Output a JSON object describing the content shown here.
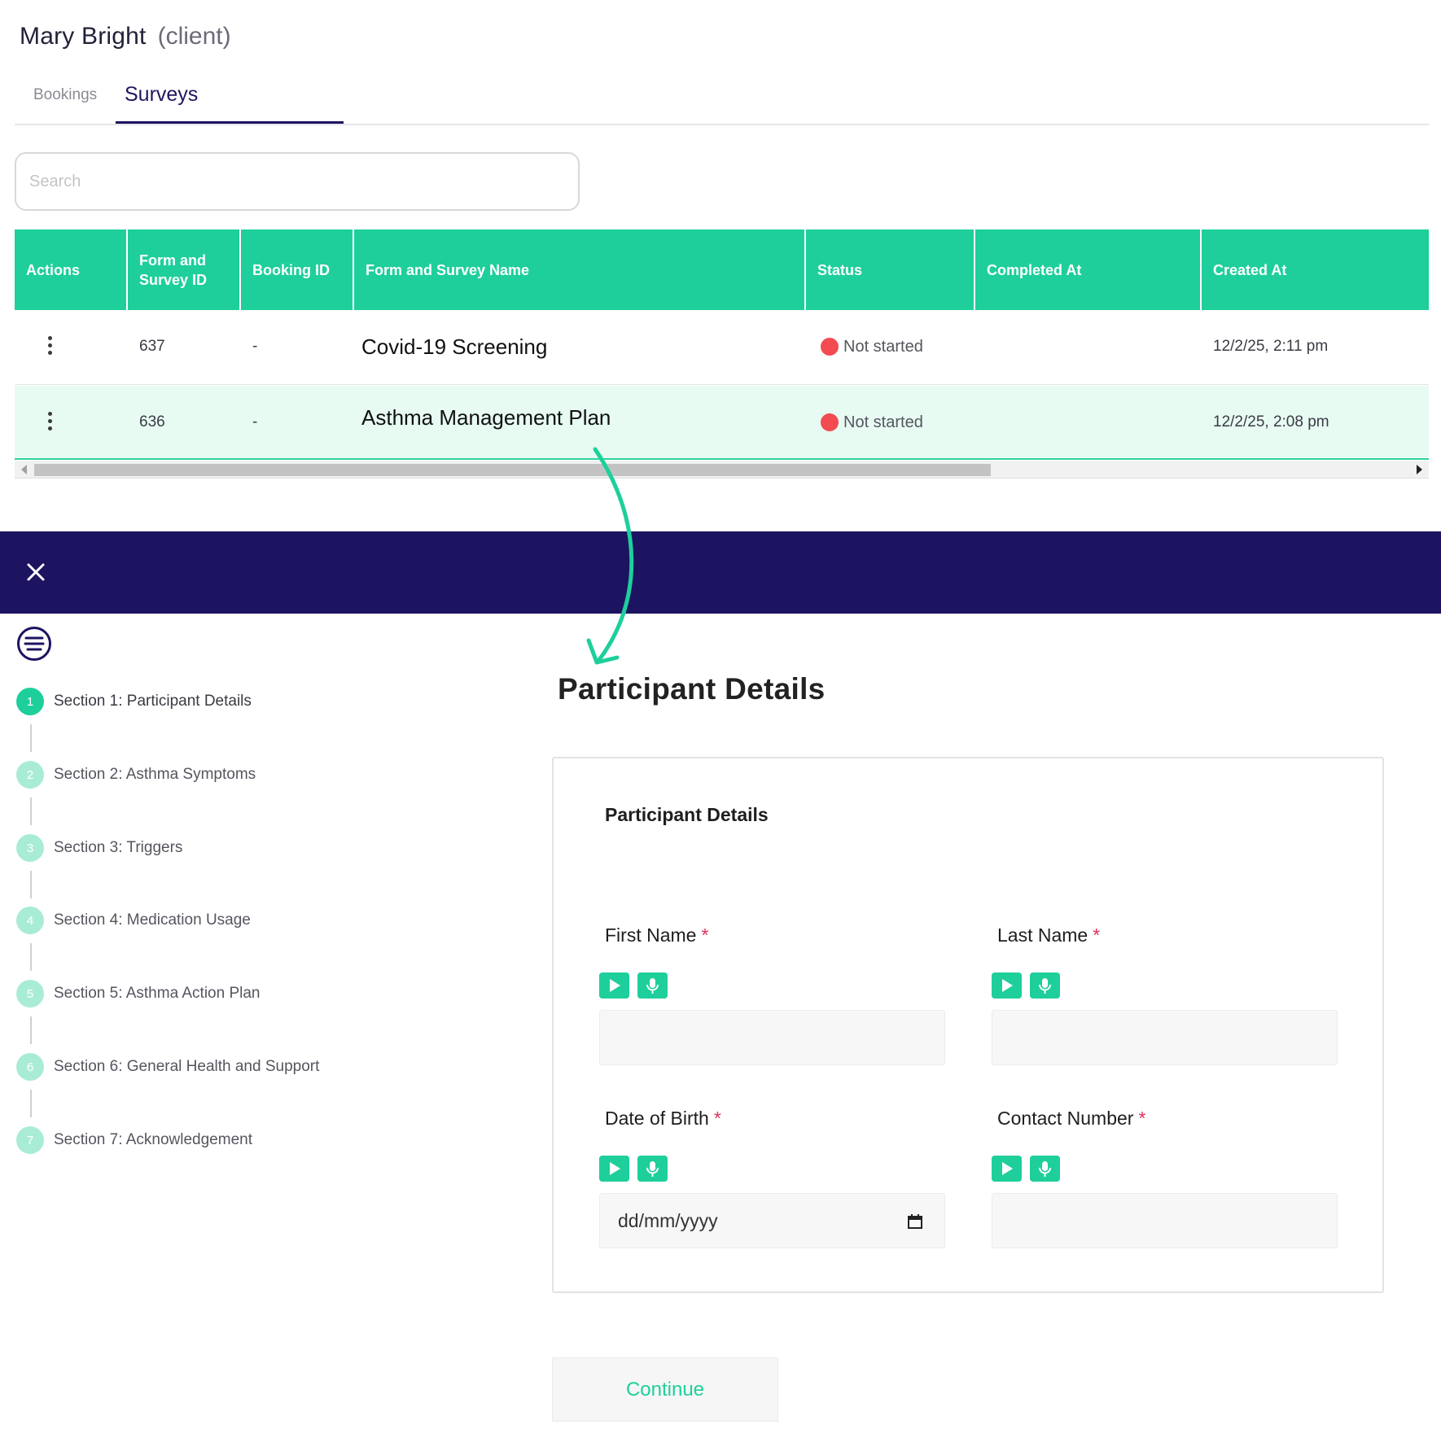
{
  "client": {
    "name": "Mary Bright",
    "role": "(client)"
  },
  "tabs": [
    {
      "label": "Bookings"
    },
    {
      "label": "Surveys"
    }
  ],
  "search": {
    "placeholder": "Search",
    "value": ""
  },
  "table": {
    "headers": [
      "Actions",
      "Form and Survey ID",
      "Booking ID",
      "Form and Survey Name",
      "Status",
      "Completed At",
      "Created At"
    ],
    "rows": [
      {
        "id": "637",
        "booking_id": "-",
        "name": "Covid-19 Screening",
        "status": "Not started",
        "completed_at": "",
        "created_at": "12/2/25, 2:11 pm"
      },
      {
        "id": "636",
        "booking_id": "-",
        "name": "Asthma Management Plan",
        "status": "Not started",
        "completed_at": "",
        "created_at": "12/2/25, 2:08 pm"
      }
    ]
  },
  "sections": [
    {
      "number": "1",
      "label": "Section 1: Participant Details"
    },
    {
      "number": "2",
      "label": "Section 2: Asthma Symptoms"
    },
    {
      "number": "3",
      "label": "Section 3: Triggers"
    },
    {
      "number": "4",
      "label": "Section 4: Medication Usage"
    },
    {
      "number": "5",
      "label": "Section 5: Asthma Action Plan"
    },
    {
      "number": "6",
      "label": "Section 6: General Health and Support"
    },
    {
      "number": "7",
      "label": "Section 7: Acknowledgement"
    }
  ],
  "form": {
    "page_title": "Participant Details",
    "card_title": "Participant Details",
    "fields": [
      {
        "label": "First Name",
        "required": "*",
        "value": ""
      },
      {
        "label": "Last Name",
        "required": "*",
        "value": ""
      },
      {
        "label": "Date of Birth",
        "required": "*",
        "value": "dd/mm/yyyy"
      },
      {
        "label": "Contact Number",
        "required": "*",
        "value": ""
      }
    ],
    "continue_label": "Continue"
  },
  "colors": {
    "accent": "#1ecf9b",
    "navbar": "#1c1461",
    "status_not_started": "#f24b50",
    "required": "#e0315c"
  },
  "icons": [
    "kebab-icon",
    "close-icon",
    "menu-lines-icon",
    "play-icon",
    "microphone-icon",
    "calendar-icon",
    "connector-arrow"
  ]
}
